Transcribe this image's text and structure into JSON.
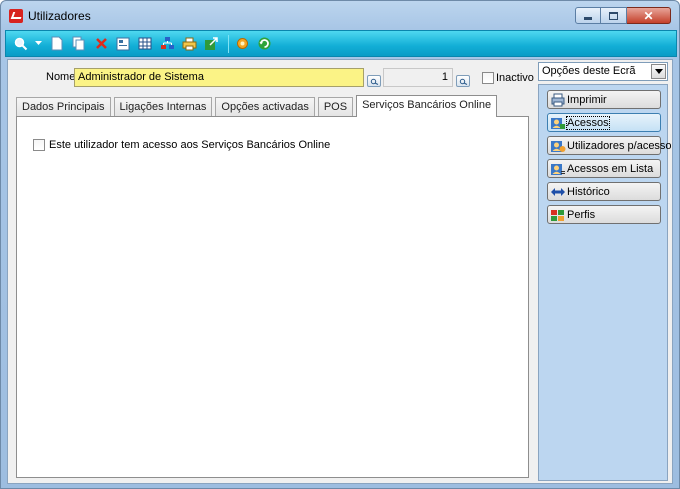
{
  "window": {
    "title": "Utilizadores",
    "accent": "#d8231f",
    "controls": {
      "minimize": "minimize-icon",
      "maximize": "maximize-icon",
      "close": "close-icon"
    }
  },
  "toolbar": {
    "color": "#12aed6",
    "icons": [
      "search-icon",
      "dropdown-arrow-icon",
      "new-document-icon",
      "copy-document-icon",
      "delete-icon",
      "properties-icon",
      "grid-icon",
      "organization-icon",
      "print-preview-icon",
      "export-icon",
      "settings-icon",
      "refresh-icon"
    ]
  },
  "form": {
    "name_label": "Nome",
    "name_value": "Administrador de Sistema",
    "id_value": "1",
    "inactive_label": "Inactivo",
    "inactive_checked": false
  },
  "tabs": [
    {
      "label": "Dados Principais",
      "active": false
    },
    {
      "label": "Ligações Internas",
      "active": false
    },
    {
      "label": "Opções activadas",
      "active": false
    },
    {
      "label": "POS",
      "active": false
    },
    {
      "label": "Serviços Bancários Online",
      "active": true
    }
  ],
  "panel": {
    "online_banking_label": "Este utilizador tem acesso aos Serviços Bancários Online",
    "online_banking_checked": false
  },
  "sidebar": {
    "options_combo": "Opções deste Ecrã",
    "actions": [
      {
        "label": "Imprimir",
        "icon": "printer-icon"
      },
      {
        "label": "Acessos",
        "icon": "access-icon",
        "focused": true
      },
      {
        "label": "Utilizadores p/acesso",
        "icon": "users-access-icon"
      },
      {
        "label": "Acessos em Lista",
        "icon": "access-list-icon"
      },
      {
        "label": "Histórico",
        "icon": "history-icon"
      },
      {
        "label": "Perfis",
        "icon": "profiles-icon"
      }
    ]
  }
}
